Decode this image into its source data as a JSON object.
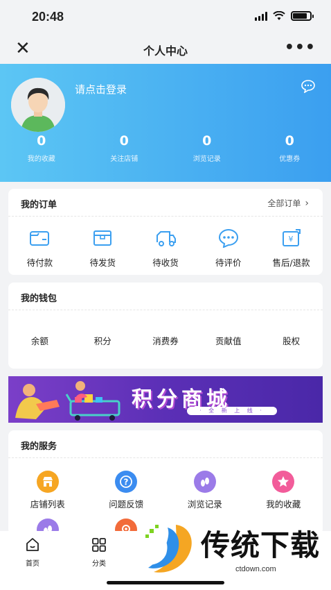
{
  "status_bar": {
    "time": "20:48",
    "battery_level": 0.85
  },
  "nav": {
    "title": "个人中心",
    "close_glyph": "✕",
    "more_glyph": "•••"
  },
  "header": {
    "login_text": "请点击登录",
    "stats": [
      {
        "value": "0",
        "label": "我的收藏"
      },
      {
        "value": "0",
        "label": "关注店铺"
      },
      {
        "value": "0",
        "label": "浏览记录"
      },
      {
        "value": "0",
        "label": "优惠券"
      }
    ]
  },
  "orders": {
    "title": "我的订单",
    "all_link": "全部订单",
    "items": [
      {
        "label": "待付款",
        "icon": "wallet-icon"
      },
      {
        "label": "待发货",
        "icon": "box-icon"
      },
      {
        "label": "待收货",
        "icon": "truck-icon"
      },
      {
        "label": "待评价",
        "icon": "comment-icon"
      },
      {
        "label": "售后/退款",
        "icon": "refund-icon"
      }
    ]
  },
  "wallet": {
    "title": "我的钱包",
    "items": [
      "余额",
      "积分",
      "消费券",
      "贡献值",
      "股权"
    ]
  },
  "banner": {
    "title": "积分商城",
    "subtitle": "· 全 新 上 线 ·"
  },
  "services": {
    "title": "我的服务",
    "items": [
      {
        "label": "店铺列表",
        "icon": "store-icon",
        "color": "#f6a623"
      },
      {
        "label": "问题反馈",
        "icon": "question-icon",
        "color": "#3b8cf0"
      },
      {
        "label": "浏览记录",
        "icon": "footprint-icon",
        "color": "#9b7be8"
      },
      {
        "label": "我的收藏",
        "icon": "star-icon",
        "color": "#f25c9a"
      }
    ],
    "row2": [
      {
        "icon": "footprint-icon",
        "color": "#9b7be8"
      },
      {
        "icon": "location-icon",
        "color": "#f26b3a"
      }
    ]
  },
  "tabs": [
    {
      "label": "首页",
      "icon": "home-icon"
    },
    {
      "label": "分类",
      "icon": "category-icon"
    }
  ],
  "watermark": {
    "text": "传统下载",
    "url": "ctdown.com"
  },
  "colors": {
    "header_start": "#5cc6f4",
    "header_end": "#3b9ff0",
    "icon_blue": "#3b9ff0"
  }
}
